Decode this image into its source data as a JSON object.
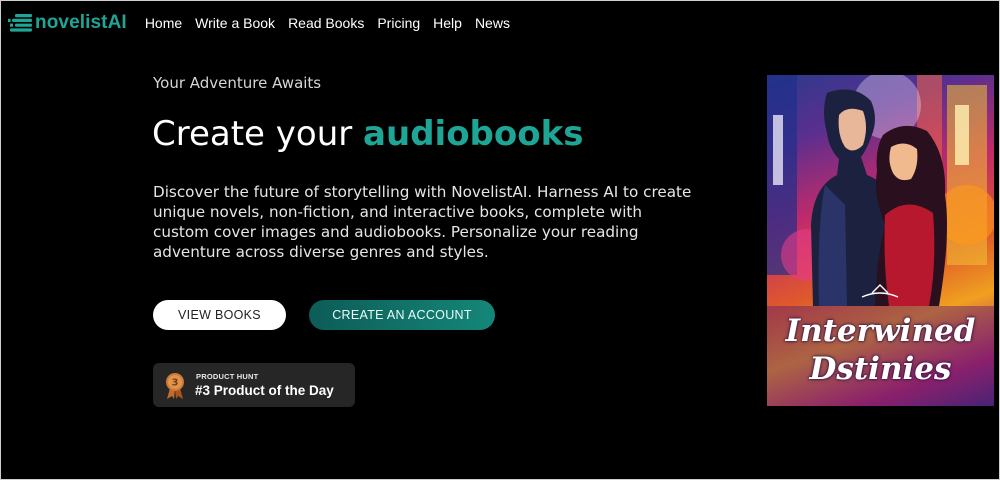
{
  "brand": {
    "name": "novelistAI",
    "color": "#1fa596",
    "icon": "stacked-bars-logo-icon"
  },
  "nav": {
    "items": [
      {
        "label": "Home"
      },
      {
        "label": "Write a Book"
      },
      {
        "label": "Read Books"
      },
      {
        "label": "Pricing"
      },
      {
        "label": "Help"
      },
      {
        "label": "News"
      }
    ]
  },
  "hero": {
    "eyebrow": "Your Adventure Awaits",
    "headline_prefix": "Create your ",
    "headline_accent": "audiobooks",
    "description": "Discover the future of storytelling with NovelistAI. Harness AI to create unique novels, non-fiction, and interactive books, complete with custom cover images and audiobooks. Personalize your reading adventure across diverse genres and styles.",
    "buttons": {
      "view_books": "VIEW BOOKS",
      "create_account": "CREATE AN ACCOUNT"
    }
  },
  "product_hunt": {
    "label": "PRODUCT HUNT",
    "title": "#3 Product of the Day",
    "rank": "3",
    "icon": "bronze-medal-icon"
  },
  "book_cover": {
    "title_line1": "Interwined",
    "title_line2": "Dstinies",
    "illustration": "couple-in-neon-city-illustration"
  },
  "colors": {
    "accent": "#1fa596",
    "background": "#000000",
    "button_teal": "#148779"
  }
}
